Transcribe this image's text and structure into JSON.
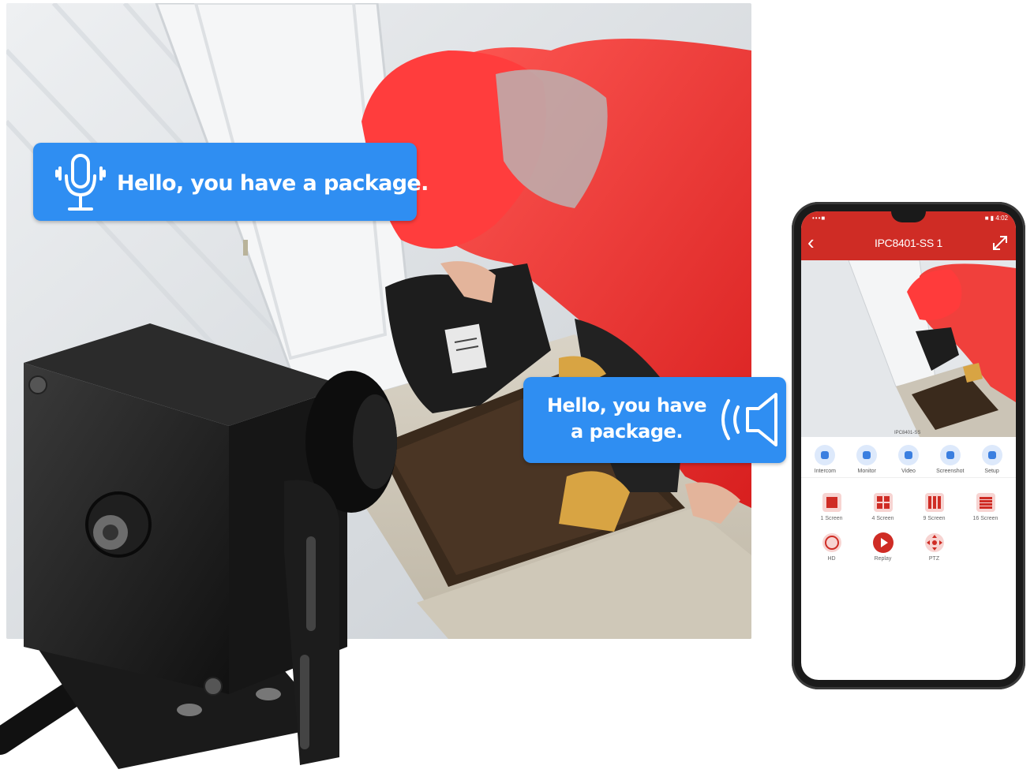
{
  "bubbles": {
    "mic_text": "Hello, you have a package.",
    "speaker_line1": "Hello, you have",
    "speaker_line2": "a package.",
    "color": "#2f8ef2"
  },
  "phone": {
    "status_left": "•••■",
    "status_right": "■ ▮ 4:02",
    "title": "IPC8401-SS 1",
    "back_icon": "chevron-left-icon",
    "fullscreen_icon": "expand-icon",
    "feed_watermark": "IPC8401-SS",
    "controls": [
      {
        "label": "Intercom",
        "icon": "microphone-icon"
      },
      {
        "label": "Monitor",
        "icon": "speaker-icon"
      },
      {
        "label": "Video",
        "icon": "video-icon"
      },
      {
        "label": "Screenshot",
        "icon": "scissors-icon"
      },
      {
        "label": "Setup",
        "icon": "gear-icon"
      }
    ],
    "grid": [
      {
        "label": "1 Screen",
        "icon": "one-screen-icon"
      },
      {
        "label": "4 Screen",
        "icon": "four-screen-icon"
      },
      {
        "label": "9 Screen",
        "icon": "nine-screen-icon"
      },
      {
        "label": "16 Screen",
        "icon": "sixteen-screen-icon"
      },
      {
        "label": "HD",
        "icon": "hd-icon"
      },
      {
        "label": "Replay",
        "icon": "play-icon"
      },
      {
        "label": "PTZ",
        "icon": "ptz-icon"
      }
    ],
    "accent": "#cf2c25"
  }
}
